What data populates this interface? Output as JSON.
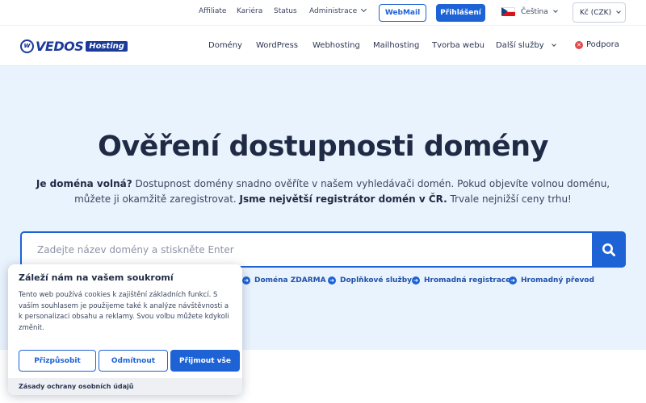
{
  "topbar": {
    "links": [
      "Affiliate",
      "Kariéra",
      "Status",
      "Administrace"
    ],
    "webmail_label": "WebMail",
    "login_label": "Přihlášení",
    "language": "Čeština",
    "currency": "Kč (CZK)"
  },
  "nav": {
    "logo_text": "VEDOS",
    "logo_badge": "Hosting",
    "items": [
      "Domény",
      "WordPress",
      "Webhosting",
      "Mailhosting",
      "Tvorba webu",
      "Další služby"
    ],
    "support_label": "Podpora"
  },
  "hero": {
    "title": "Ověření dostupnosti domény",
    "text_bold_1": "Je doména volná?",
    "text_1": " Dostupnost domény snadno ověříte v našem vyhledávači domén. Pokud objevíte volnou doménu, můžete ji okamžitě zaregistrovat. ",
    "text_bold_2": "Jsme největší registrátor domén v ČR.",
    "text_2": " Trvale nejnižší ceny trhu!"
  },
  "search": {
    "placeholder": "Zadejte název domény a stiskněte Enter",
    "value": ""
  },
  "quick_links": [
    "Doména ZDARMA",
    "Doplňkové služby",
    "Hromadná registrace",
    "Hromadný převod"
  ],
  "cookie": {
    "title": "Záleží nám na vašem soukromí",
    "text": "Tento web používá cookies k zajištění základních funkcí. S vaším souhlasem je použijeme také k analýze návštěvnosti a k personalizaci obsahu a reklamy. Svou volbu můžete kdykoli změnit.",
    "customize_label": "Přizpůsobit",
    "reject_label": "Odmítnout",
    "accept_label": "Přijmout vše",
    "policy_link": "Zásady ochrany osobních údajů"
  },
  "colors": {
    "accent": "#1e63d6",
    "brand": "#1b3a9a",
    "hero_bg": "#e9f3fd",
    "text": "#1f2a44"
  },
  "icons": {
    "search": "search-icon",
    "arrow": "arrow-right-circle-icon",
    "support": "close-circle-icon",
    "flag": "czech-flag-icon"
  }
}
